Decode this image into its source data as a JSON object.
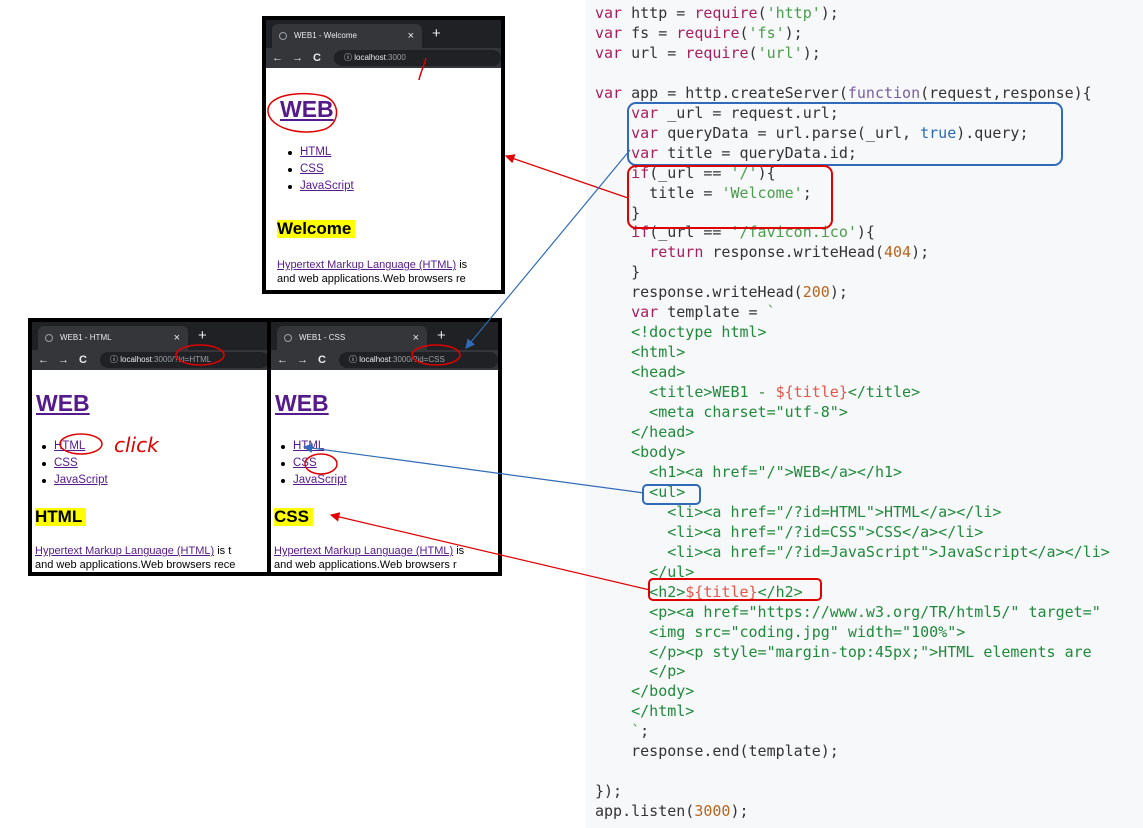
{
  "browser_top": {
    "tab_title": "WEB1 - Welcome",
    "address_host": "localhost",
    "address_path": ":3000",
    "heading": "WEB",
    "list": [
      "HTML",
      "CSS",
      "JavaScript"
    ],
    "h2": "Welcome",
    "para_link": "Hypertext Markup Language (HTML)",
    "para_after": " is",
    "para_line2": "and web applications.Web browsers re"
  },
  "browser_left": {
    "tab_title": "WEB1 - HTML",
    "address_host": "localhost",
    "address_path": ":3000/?id=HTML",
    "heading": "WEB",
    "list": [
      "HTML",
      "CSS",
      "JavaScript"
    ],
    "h2": "HTML",
    "para_link": "Hypertext Markup Language (HTML)",
    "para_after": " is t",
    "para_line2": "and web applications.Web browsers rece",
    "handwritten_note": "click"
  },
  "browser_right": {
    "tab_title": "WEB1 - CSS",
    "address_host": "localhost",
    "address_path": ":3000/?id=CSS",
    "heading": "WEB",
    "list": [
      "HTML",
      "CSS",
      "JavaScript"
    ],
    "h2": "CSS",
    "para_link": "Hypertext Markup Language (HTML)",
    "para_after": " is",
    "para_line2": "and web applications.Web browsers r"
  },
  "icons": {
    "globe": "globe-icon",
    "close": "close-icon",
    "new_tab": "plus-icon",
    "back": "back-arrow-icon",
    "forward": "forward-arrow-icon",
    "reload": "reload-icon",
    "info": "info-icon"
  },
  "glyphs": {
    "close": "×",
    "plus": "+",
    "back": "←",
    "forward": "→",
    "reload": "C",
    "info": "ⓘ"
  },
  "code_lines": [
    "var http = require('http');",
    "var fs = require('fs');",
    "var url = require('url');",
    "",
    "var app = http.createServer(function(request,response){",
    "    var _url = request.url;",
    "    var queryData = url.parse(_url, true).query;",
    "    var title = queryData.id;",
    "    if(_url == '/'){",
    "      title = 'Welcome';",
    "    }",
    "    if(_url == '/favicon.ico'){",
    "      return response.writeHead(404);",
    "    }",
    "    response.writeHead(200);",
    "    var template = `",
    "    <!doctype html>",
    "    <html>",
    "    <head>",
    "      <title>WEB1 - ${title}</title>",
    "      <meta charset=\"utf-8\">",
    "    </head>",
    "    <body>",
    "      <h1><a href=\"/\">WEB</a></h1>",
    "      <ul>",
    "        <li><a href=\"/?id=HTML\">HTML</a></li>",
    "        <li><a href=\"/?id=CSS\">CSS</a></li>",
    "        <li><a href=\"/?id=JavaScript\">JavaScript</a></li>",
    "      </ul>",
    "      <h2>${title}</h2>",
    "      <p><a href=\"https://www.w3.org/TR/html5/\" target=\"",
    "      <img src=\"coding.jpg\" width=\"100%\">",
    "      </p><p style=\"margin-top:45px;\">HTML elements are",
    "      </p>",
    "    </body>",
    "    </html>",
    "    `;",
    "    response.end(template);",
    "",
    "});",
    "app.listen(3000);"
  ],
  "colors": {
    "annotation_red": "#e00000",
    "annotation_blue": "#2f6bb8",
    "highlight": "#ffff00",
    "link": "#551a8b"
  }
}
